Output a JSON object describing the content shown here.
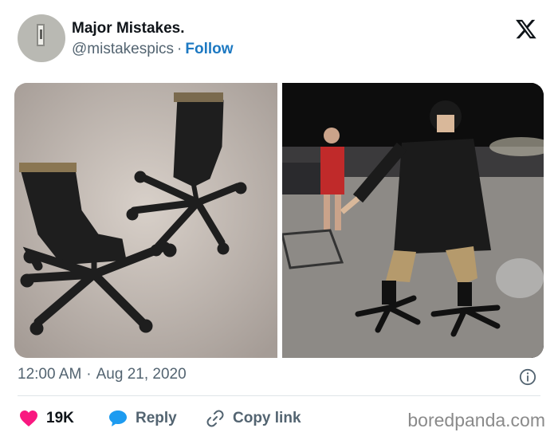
{
  "tweet": {
    "display_name": "Major Mistakes.",
    "handle": "@mistakespics",
    "separator": "·",
    "follow_label": "Follow",
    "time": "12:00 AM",
    "date": "Aug 21, 2020"
  },
  "actions": {
    "likes_count": "19K",
    "reply_label": "Reply",
    "copy_link_label": "Copy link"
  },
  "watermark": "boredpanda.com",
  "icons": {
    "brand": "x-logo-icon",
    "info": "info-icon",
    "like": "heart-icon",
    "reply": "speech-bubble-icon",
    "copy": "link-icon"
  },
  "colors": {
    "like": "#f91880",
    "reply": "#1d9bf0",
    "follow": "#1d79c2",
    "muted_text": "#536471"
  }
}
